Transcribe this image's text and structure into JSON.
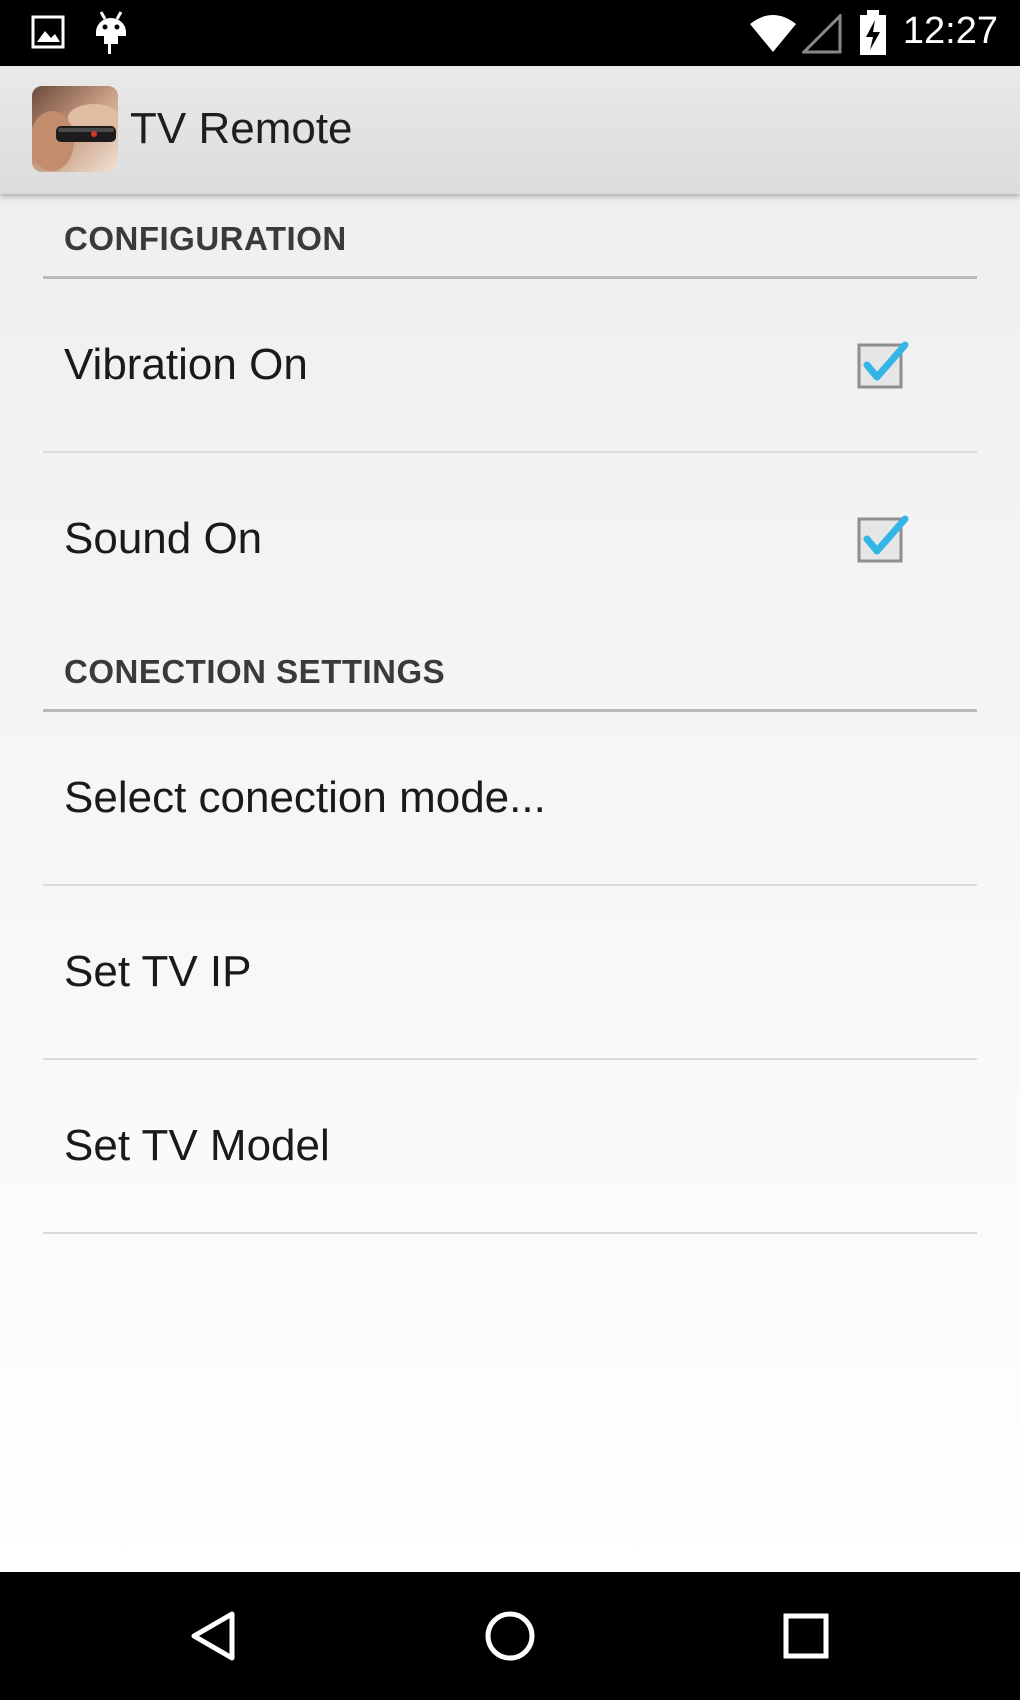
{
  "status_bar": {
    "time": "12:27",
    "icons": [
      "image-notification-icon",
      "android-notification-icon",
      "wifi-icon",
      "cell-signal-icon",
      "battery-charging-icon"
    ]
  },
  "action_bar": {
    "title": "TV Remote",
    "icon": "tv-remote-app-icon"
  },
  "sections": {
    "configuration": {
      "header": "CONFIGURATION",
      "items": [
        {
          "label": "Vibration On",
          "checked": true
        },
        {
          "label": "Sound On",
          "checked": true
        }
      ]
    },
    "connection": {
      "header": "CONECTION SETTINGS",
      "items": [
        {
          "label": "Select conection mode..."
        },
        {
          "label": "Set TV IP"
        },
        {
          "label": "Set TV Model"
        }
      ]
    }
  },
  "colors": {
    "accent": "#33b5e5",
    "status_bar": "#000000",
    "action_bar": "#dcdcdc"
  },
  "nav_bar": {
    "buttons": [
      "back-icon",
      "home-icon",
      "recents-icon"
    ]
  }
}
